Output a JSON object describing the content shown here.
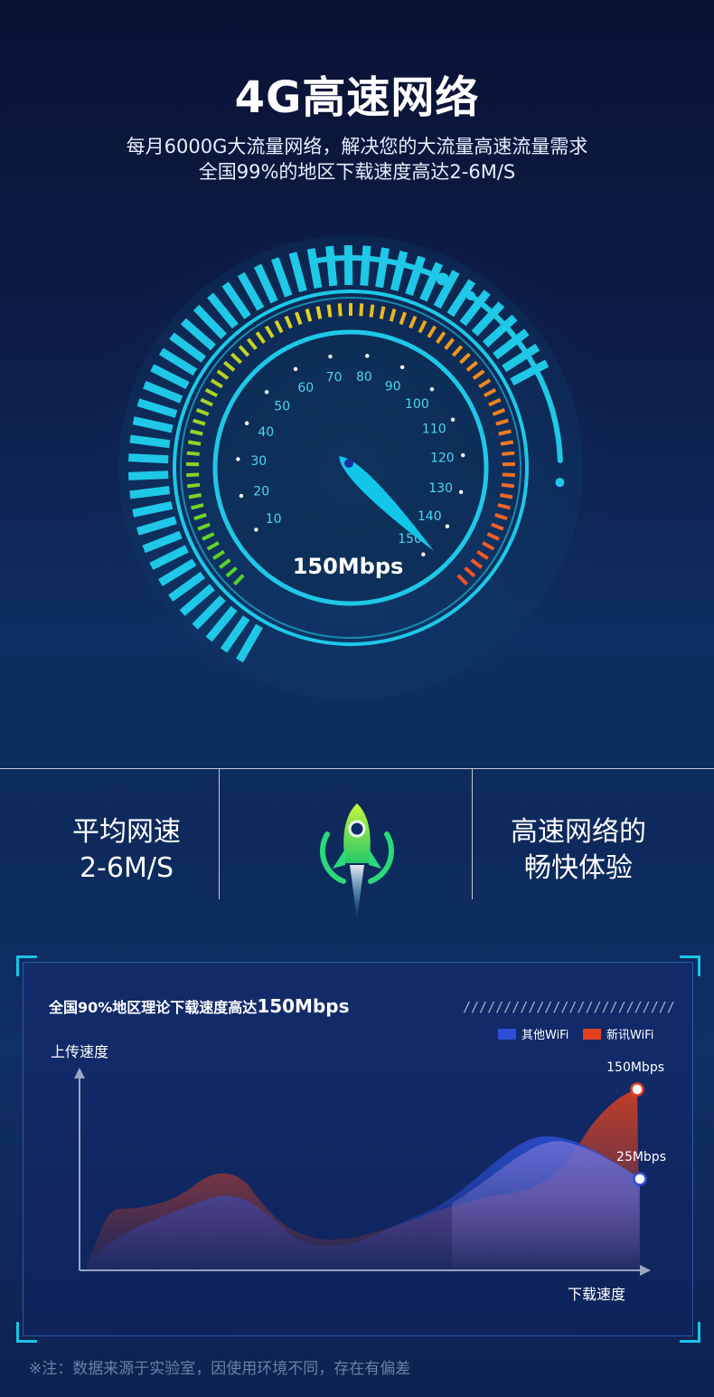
{
  "header": {
    "title": "4G高速网络",
    "subtitle_line1": "每月6000G大流量网络，解决您的大流量高速流量需求",
    "subtitle_line2": "全国99%的地区下载速度高达2-6M/S"
  },
  "gauge": {
    "tick_labels": [
      "10",
      "20",
      "30",
      "40",
      "50",
      "60",
      "70",
      "80",
      "90",
      "100",
      "110",
      "120",
      "130",
      "140",
      "150"
    ],
    "readout": "150Mbps",
    "needle_value": 150,
    "colors": {
      "accent": "#1ec8e6",
      "green": "#4fd42a",
      "yellow": "#e8d21e",
      "orange": "#f08a1e",
      "red": "#f0502a"
    }
  },
  "stats": {
    "left_line1": "平均网速",
    "left_line2": "2-6M/S",
    "right_line1": "高速网络的",
    "right_line2": "畅快体验",
    "center_icon": "rocket-icon"
  },
  "chart_panel": {
    "title_prefix": "全国90%地区理论下载速度高达",
    "title_highlight": "150Mbps",
    "stripes": "//////////////////////////"
  },
  "chart_data": {
    "type": "area",
    "xlabel": "下载速度",
    "ylabel": "上传速度",
    "series": [
      {
        "name": "其他WiFi",
        "color": "#2d4fd6",
        "end_label": "25Mbps"
      },
      {
        "name": "新讯WiFi",
        "color": "#e2421e",
        "end_label": "150Mbps"
      }
    ]
  },
  "footnote": "※注：数据来源于实验室，因使用环境不同，存在有偏差"
}
